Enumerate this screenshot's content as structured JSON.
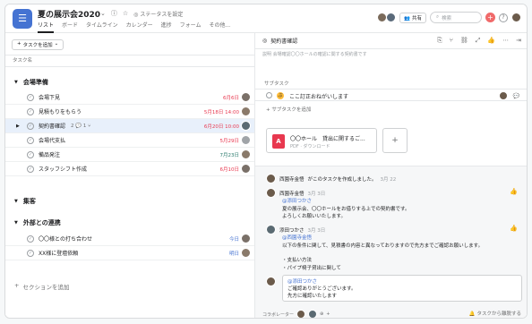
{
  "header": {
    "project_title": "夏の展示会2020",
    "status_label": "ステータスを設定",
    "tabs": [
      "リスト",
      "ボード",
      "タイムライン",
      "カレンダー",
      "進捗",
      "フォーム",
      "その他..."
    ],
    "share_label": "共有",
    "search_placeholder": "検索",
    "help_label": "?"
  },
  "left": {
    "add_task_label": "タスクを追加",
    "column_header": "タスク名",
    "sections": [
      {
        "title": "会場準備",
        "tasks": [
          {
            "name": "会場下見",
            "due": "6月6日",
            "due_color": "red"
          },
          {
            "name": "見積もりをもらう",
            "due": "5月18日 14:00",
            "due_color": "red"
          },
          {
            "name": "契約書確認",
            "comments": "2",
            "subtasks": "1",
            "due": "6月20日 10:00",
            "due_color": "red",
            "selected": true
          },
          {
            "name": "会場代支払",
            "due": "5月29日",
            "due_color": "red"
          },
          {
            "name": "備品発注",
            "due": "7月23日",
            "due_color": "green"
          },
          {
            "name": "スタッフシフト作成",
            "due": "6月10日",
            "due_color": "red"
          }
        ]
      },
      {
        "title": "集客",
        "tasks": []
      },
      {
        "title": "外部との連携",
        "tasks": [
          {
            "name": "〇〇様との打ち合わせ",
            "due": "今日",
            "due_color": "blue"
          },
          {
            "name": "XX様に登壇依頼",
            "due": "明日",
            "due_color": "blue"
          }
        ]
      }
    ],
    "add_section_label": "セクションを追加"
  },
  "detail": {
    "mark_complete_title": "契約書確認",
    "cut_text": "説明                会場確認〇〇ホールの確認に関する契約書です",
    "subtasks_label": "サブタスク",
    "subtask": {
      "badge": "ぶ",
      "name": "ここ訂正おねがいします"
    },
    "add_subtask_label": "サブタスクを追加",
    "attachment": {
      "name": "〇〇ホール　貸出に関するご...",
      "sub": "PDF · ダウンロード",
      "icon_text": "A"
    },
    "activity": {
      "created": {
        "name": "西園寺金悟",
        "text": "がこのタスクを作成しました。",
        "time": "3月 22"
      },
      "comments": [
        {
          "author": "西園寺金悟",
          "time": "3月 3日",
          "mention": "@添田つかさ",
          "lines": [
            "夏の展示会、〇〇ホールをお借りする上での契約書です。",
            "よろしくお願いいたします。"
          ]
        },
        {
          "author": "添田つかさ",
          "time": "3月 3日",
          "mention": "@西園寺金悟",
          "lines": [
            "以下の条件に関して、見積書の内容と異なっておりますので先方までご確認お願いします。",
            "",
            "・支払い方法",
            "・パイプ椅子貸出に関して"
          ]
        }
      ],
      "compose": {
        "mention": "@添田つかさ",
        "lines": [
          "ご確認ありがとうございます。",
          "先方に確認いたします"
        ]
      }
    },
    "collaborators_label": "コラボレーター",
    "leave_label": "タスクから離脱する"
  },
  "colors": {
    "brand": "#4573d2",
    "red": "#e8384f",
    "green": "#2a7a6c",
    "blue": "#4573d2",
    "selected_row": "#e8f0fb"
  }
}
